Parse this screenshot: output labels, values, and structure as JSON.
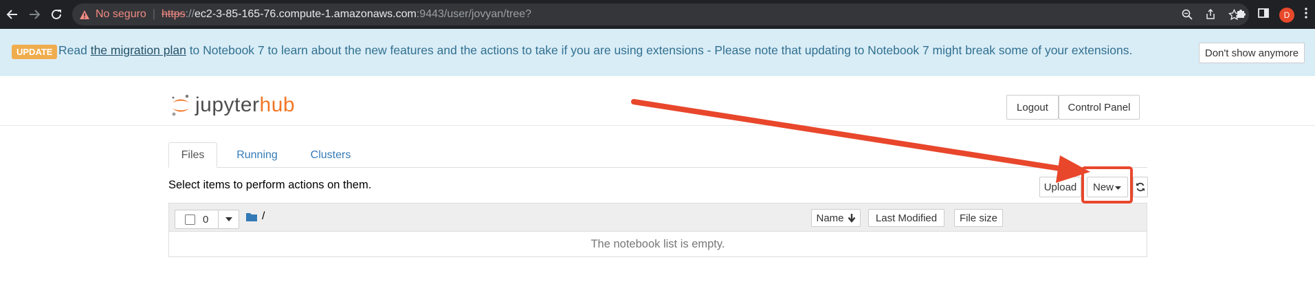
{
  "browser": {
    "security_label": "No seguro",
    "url_scheme": "https",
    "url_sep": "://",
    "url_host": "ec2-3-85-165-76.compute-1.amazonaws.com",
    "url_path": ":9443/user/jovyan/tree?",
    "profile_initial": "D"
  },
  "banner": {
    "badge": "UPDATE",
    "text_before": "Read ",
    "link": "the migration plan",
    "text_after": " to Notebook 7 to learn about the new features and the actions to take if you are using extensions - Please note that updating to Notebook 7 might break some of your extensions.",
    "dismiss": "Don't show anymore"
  },
  "header": {
    "logo_word": "jupyter",
    "logo_hub": "hub",
    "logout": "Logout",
    "control_panel": "Control Panel"
  },
  "tabs": [
    {
      "label": "Files"
    },
    {
      "label": "Running"
    },
    {
      "label": "Clusters"
    }
  ],
  "toolbar": {
    "instructions": "Select items to perform actions on them.",
    "upload": "Upload",
    "new": "New"
  },
  "list": {
    "selected_count": "0",
    "path": "/",
    "col_name": "Name",
    "col_modified": "Last Modified",
    "col_size": "File size",
    "empty_message": "The notebook list is empty."
  },
  "colors": {
    "annotation": "#e8472c",
    "jupyter_orange": "#f37626",
    "banner_bg": "#d9edf7",
    "link_blue": "#337ab7"
  }
}
